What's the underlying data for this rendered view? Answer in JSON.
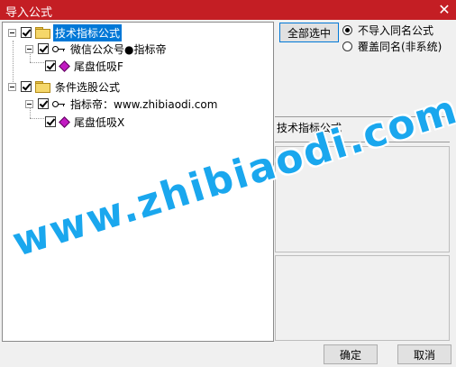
{
  "window": {
    "title": "导入公式",
    "close_glyph": "✕"
  },
  "tree": {
    "nodes": [
      {
        "label": "技术指标公式",
        "checked": true,
        "selected": true
      },
      {
        "label": "微信公众号●指标帝",
        "checked": true
      },
      {
        "label": "尾盘低吸F",
        "checked": true
      },
      {
        "label": "条件选股公式",
        "checked": true
      },
      {
        "label": "指标帝：www.zhibiaodi.com",
        "checked": true
      },
      {
        "label": "尾盘低吸X",
        "checked": true
      }
    ]
  },
  "right_panel": {
    "select_all_label": "全部选中",
    "options": [
      {
        "label": "不导入同名公式",
        "selected": true
      },
      {
        "label": "覆盖同名(非系统)",
        "selected": false
      }
    ],
    "formula_type_label": "技术指标公式"
  },
  "footer": {
    "ok_label": "确定",
    "cancel_label": "取消"
  },
  "watermark": "www.zhibiaodi.com",
  "colors": {
    "titlebar": "#c41e24",
    "selection": "#0078d7",
    "watermark": "#1aa7ee"
  }
}
